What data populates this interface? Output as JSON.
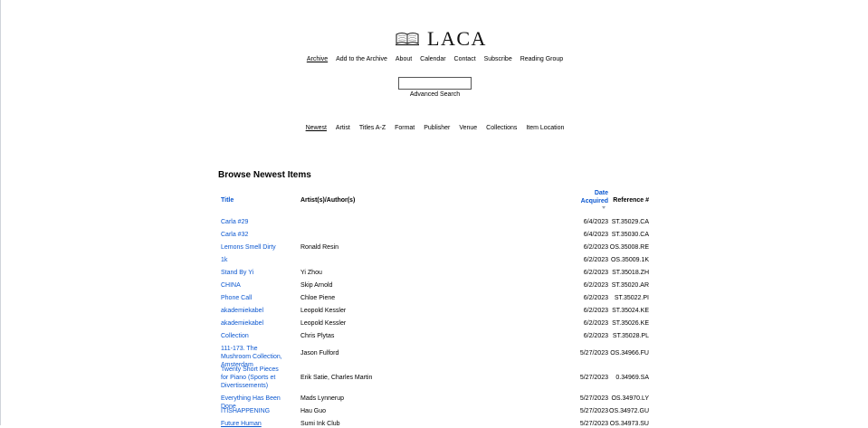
{
  "site": {
    "name": "LACA",
    "logo_icon": "open-book-icon"
  },
  "nav": [
    {
      "label": "Archive",
      "active": true
    },
    {
      "label": "Add to the Archive",
      "active": false
    },
    {
      "label": "About",
      "active": false
    },
    {
      "label": "Calendar",
      "active": false
    },
    {
      "label": "Contact",
      "active": false
    },
    {
      "label": "Subscribe",
      "active": false
    },
    {
      "label": "Reading Group",
      "active": false
    }
  ],
  "search": {
    "value": "",
    "placeholder": "",
    "advanced_label": "Advanced Search"
  },
  "browse_tabs": [
    {
      "label": "Newest",
      "active": true
    },
    {
      "label": "Artist",
      "active": false
    },
    {
      "label": "Titles A-Z",
      "active": false
    },
    {
      "label": "Format",
      "active": false
    },
    {
      "label": "Publisher",
      "active": false
    },
    {
      "label": "Venue",
      "active": false
    },
    {
      "label": "Collections",
      "active": false
    },
    {
      "label": "Item Location",
      "active": false
    }
  ],
  "page_title": "Browse Newest Items",
  "table": {
    "columns": {
      "title": "Title",
      "artist": "Artist(s)/Author(s)",
      "date": "Date Acquired",
      "ref": "Reference #"
    },
    "sort_icon": "caret-down-icon",
    "rows": [
      {
        "title": "Carla #29",
        "artist": "",
        "date": "6/4/2023",
        "ref": "ST.35029.CA"
      },
      {
        "title": "Carla #32",
        "artist": "",
        "date": "6/4/2023",
        "ref": "ST.35030.CA"
      },
      {
        "title": "Lemons Smell Dirty",
        "artist": "Ronald Resin",
        "date": "6/2/2023",
        "ref": "OS.35008.RE"
      },
      {
        "title": "1k",
        "artist": "",
        "date": "6/2/2023",
        "ref": "OS.35009.1K"
      },
      {
        "title": "Stand By Yi",
        "artist": "Yi Zhou",
        "date": "6/2/2023",
        "ref": "ST.35018.ZH"
      },
      {
        "title": "CHINA",
        "artist": "Skip Arnold",
        "date": "6/2/2023",
        "ref": "ST.35020.AR"
      },
      {
        "title": "Phone Call",
        "artist": "Chloe Piene",
        "date": "6/2/2023",
        "ref": "ST.35022.PI"
      },
      {
        "title": "akademiekabel",
        "artist": "Leopold Kessler",
        "date": "6/2/2023",
        "ref": "ST.35024.KE"
      },
      {
        "title": "akademiekabel",
        "artist": "Leopold Kessler",
        "date": "6/2/2023",
        "ref": "ST.35026.KE"
      },
      {
        "title": "Collection",
        "artist": "Chris Plytas",
        "date": "6/2/2023",
        "ref": "ST.35028.PL"
      },
      {
        "title": "111-173. The Mushroom Collection, Amsterdam",
        "artist": "Jason Fulford",
        "date": "5/27/2023",
        "ref": "OS.34966.FU"
      },
      {
        "title": "Twenty Short Pieces for Piano (Sports et Divertissements)",
        "artist": "Erik Satie, Charles Martin",
        "date": "5/27/2023",
        "ref": "0.34969.SA"
      },
      {
        "title": "Everything Has Been Done",
        "artist": "Mads Lynnerup",
        "date": "5/27/2023",
        "ref": "OS.34970.LY"
      },
      {
        "title": "ITISHAPPENING",
        "artist": "Hau Guo",
        "date": "5/27/2023",
        "ref": "OS.34972.GU"
      },
      {
        "title": "Future Human",
        "artist": "Sumi Ink Club",
        "date": "5/27/2023",
        "ref": "OS.34973.SU"
      }
    ]
  }
}
